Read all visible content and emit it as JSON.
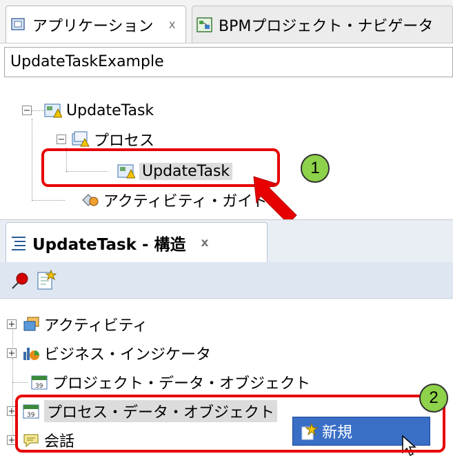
{
  "app": {
    "tabs": [
      {
        "label": "アプリケーション",
        "close": "x"
      },
      {
        "label": "BPMプロジェクト・ナビゲータ"
      }
    ],
    "project_combo": {
      "value": "UpdateTaskExample"
    },
    "tree": {
      "root": "UpdateTask",
      "process_folder": "プロセス",
      "selected_process": "UpdateTask",
      "activity_guide": "アクティビティ・ガイド"
    }
  },
  "structure": {
    "tab_label": "UpdateTask - 構造",
    "tab_close": "x",
    "items": [
      {
        "label": "アクティビティ"
      },
      {
        "label": "ビジネス・インジケータ"
      },
      {
        "label": "プロジェクト・データ・オブジェクト"
      },
      {
        "label": "プロセス・データ・オブジェクト"
      },
      {
        "label": "会話"
      }
    ],
    "context_menu": {
      "new_label": "新規"
    }
  },
  "callouts": {
    "first": "1",
    "second": "2"
  },
  "colors": {
    "annotation_red": "#e60000",
    "callout_green": "#8dd24a",
    "menu_blue": "#3a6fc6"
  }
}
